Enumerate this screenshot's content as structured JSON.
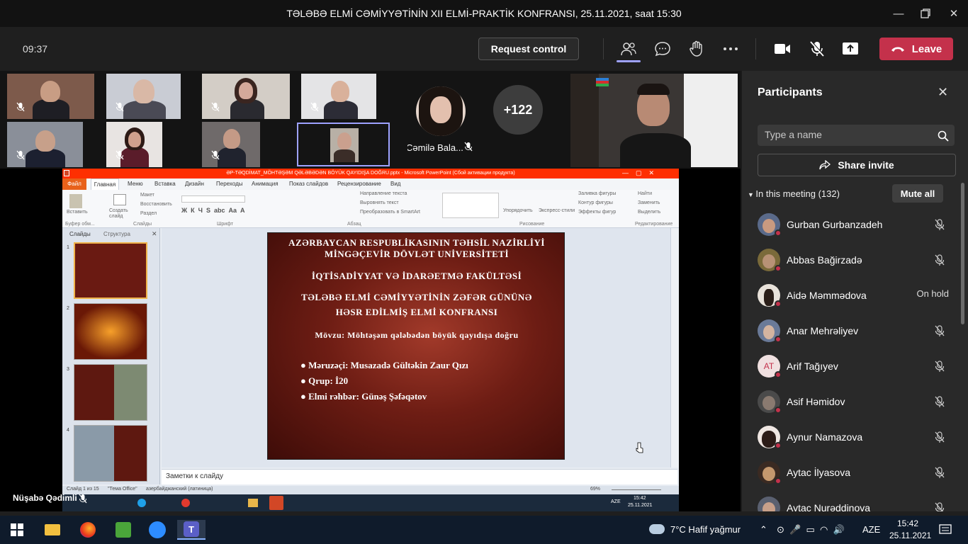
{
  "window": {
    "title": "TƏLƏBƏ ELMİ CƏMİYYƏTİNİN XII ELMİ-PRAKTİK KONFRANSI, 25.11.2021, saat 15:30"
  },
  "meeting_bar": {
    "timer": "09:37",
    "request_control": "Request control",
    "leave": "Leave",
    "icons": [
      "people-icon",
      "chat-icon",
      "raise-hand-icon",
      "more-icon",
      "camera-icon",
      "mic-off-icon",
      "share-tray-icon"
    ]
  },
  "gallery": {
    "named_tile": "Cəmilə Bala...",
    "overflow_count": "+122"
  },
  "presentation": {
    "app_title": "ƏP-TƏQDİMAT_MÖHTƏŞƏM QƏLƏBƏDƏN BÖYÜK QAYIDIŞA DOĞRU.pptx - Microsoft PowerPoint (Сбой активации продукта)",
    "tabs": [
      "Файл",
      "Главная",
      "Меню",
      "Вставка",
      "Дизайн",
      "Переходы",
      "Анимация",
      "Показ слайдов",
      "Рецензирование",
      "Вид"
    ],
    "ribbon_groups": [
      "Буфер обм...",
      "Слайды",
      "Шрифт",
      "Абзац",
      "Рисование",
      "Редактирование"
    ],
    "ribbon_items": {
      "paste": "Вставить",
      "new_slide": "Создать слайд",
      "layout": "Макет",
      "reset": "Восстановить",
      "section": "Раздел",
      "text_direction": "Направление текста",
      "align_text": "Выровнять текст",
      "smartart": "Преобразовать в SmartArt",
      "arrange": "Упорядочить",
      "quick_styles": "Экспресс-стили",
      "shape_fill": "Заливка фигуры",
      "shape_outline": "Контур фигуры",
      "shape_effects": "Эффекты фигур",
      "find": "Найти",
      "replace": "Заменить",
      "select": "Выделить"
    },
    "pane_tabs": [
      "Слайды",
      "Структура"
    ],
    "thumb_numbers": [
      "1",
      "2",
      "3",
      "4"
    ],
    "slide_lines": [
      "AZƏRBAYCAN RESPUBLİKASININ TƏHSİL NAZİRLİYİ",
      "MİNGƏÇEVİR DÖVLƏT UNİVERSİTETİ",
      "İQTİSADİYYAT  VƏ İDARƏETMƏ  FAKÜLTƏSİ",
      "TƏLƏBƏ ELMİ CƏMİYYƏTİNİN ZƏFƏR GÜNÜNƏ",
      "HƏSR  EDİLMİŞ ELMİ KONFRANSI",
      "Mövzu: Möhtəşəm qələbədən böyük qayıdışa doğru"
    ],
    "slide_bullets": [
      "Məruzəçi: Musazadə Gültəkin Zaur Qızı",
      "Qrup: İ20",
      "Elmi rəhbər: Günəş Şəfəqətov"
    ],
    "notes": "Заметки к слайду",
    "status": {
      "slide_of": "Слайд 1 из 15",
      "theme": "\"Тема Office\"",
      "language": "азербайджанский (латиница)",
      "zoom": "69%"
    },
    "inner_clock": {
      "time": "15:42",
      "date": "25.11.2021",
      "lang": "AZE"
    },
    "presenter": "Nüşabə Qədimli"
  },
  "participants": {
    "title": "Participants",
    "search_placeholder": "Type a name",
    "share_invite": "Share invite",
    "in_meeting": "In this meeting (132)",
    "mute_all": "Mute all",
    "list": [
      {
        "name": "Gurban Gurbanzadeh",
        "status": ""
      },
      {
        "name": "Abbas Bağirzadə",
        "status": ""
      },
      {
        "name": "Aidə Məmmədova",
        "status": "On hold"
      },
      {
        "name": "Anar Mehrəliyev",
        "status": ""
      },
      {
        "name": "Arif Tağıyev",
        "status": "",
        "initials": "AT"
      },
      {
        "name": "Asif Həmidov",
        "status": ""
      },
      {
        "name": "Aynur Namazova",
        "status": ""
      },
      {
        "name": "Aytac İlyasova",
        "status": ""
      },
      {
        "name": "Aytac Nurəddinova",
        "status": ""
      }
    ]
  },
  "taskbar": {
    "weather": "7°C  Hafif yağmur",
    "lang": "AZE",
    "time": "15:42",
    "date": "25.11.2021"
  },
  "colors": {
    "leave": "#c4314b",
    "ppt_title": "#fe2f01",
    "active_speaker_border": "#9ea2ff"
  }
}
